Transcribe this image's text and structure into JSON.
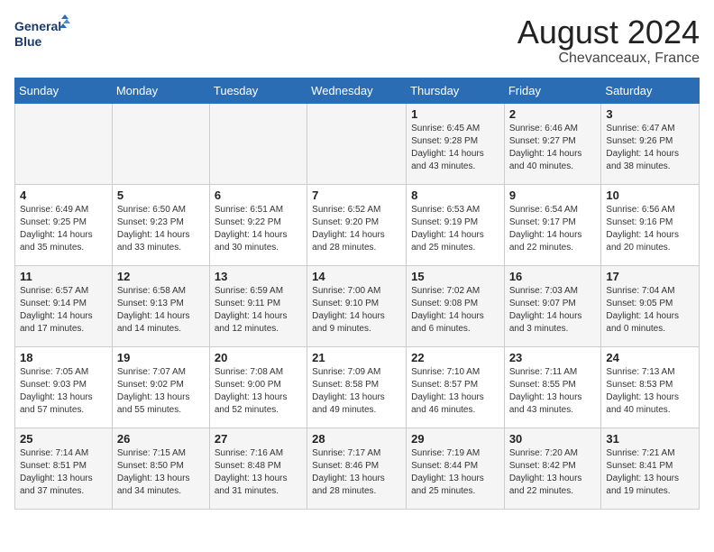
{
  "header": {
    "logo_line1": "General",
    "logo_line2": "Blue",
    "month": "August 2024",
    "location": "Chevanceaux, France"
  },
  "weekdays": [
    "Sunday",
    "Monday",
    "Tuesday",
    "Wednesday",
    "Thursday",
    "Friday",
    "Saturday"
  ],
  "weeks": [
    [
      {
        "day": "",
        "info": ""
      },
      {
        "day": "",
        "info": ""
      },
      {
        "day": "",
        "info": ""
      },
      {
        "day": "",
        "info": ""
      },
      {
        "day": "1",
        "info": "Sunrise: 6:45 AM\nSunset: 9:28 PM\nDaylight: 14 hours\nand 43 minutes."
      },
      {
        "day": "2",
        "info": "Sunrise: 6:46 AM\nSunset: 9:27 PM\nDaylight: 14 hours\nand 40 minutes."
      },
      {
        "day": "3",
        "info": "Sunrise: 6:47 AM\nSunset: 9:26 PM\nDaylight: 14 hours\nand 38 minutes."
      }
    ],
    [
      {
        "day": "4",
        "info": "Sunrise: 6:49 AM\nSunset: 9:25 PM\nDaylight: 14 hours\nand 35 minutes."
      },
      {
        "day": "5",
        "info": "Sunrise: 6:50 AM\nSunset: 9:23 PM\nDaylight: 14 hours\nand 33 minutes."
      },
      {
        "day": "6",
        "info": "Sunrise: 6:51 AM\nSunset: 9:22 PM\nDaylight: 14 hours\nand 30 minutes."
      },
      {
        "day": "7",
        "info": "Sunrise: 6:52 AM\nSunset: 9:20 PM\nDaylight: 14 hours\nand 28 minutes."
      },
      {
        "day": "8",
        "info": "Sunrise: 6:53 AM\nSunset: 9:19 PM\nDaylight: 14 hours\nand 25 minutes."
      },
      {
        "day": "9",
        "info": "Sunrise: 6:54 AM\nSunset: 9:17 PM\nDaylight: 14 hours\nand 22 minutes."
      },
      {
        "day": "10",
        "info": "Sunrise: 6:56 AM\nSunset: 9:16 PM\nDaylight: 14 hours\nand 20 minutes."
      }
    ],
    [
      {
        "day": "11",
        "info": "Sunrise: 6:57 AM\nSunset: 9:14 PM\nDaylight: 14 hours\nand 17 minutes."
      },
      {
        "day": "12",
        "info": "Sunrise: 6:58 AM\nSunset: 9:13 PM\nDaylight: 14 hours\nand 14 minutes."
      },
      {
        "day": "13",
        "info": "Sunrise: 6:59 AM\nSunset: 9:11 PM\nDaylight: 14 hours\nand 12 minutes."
      },
      {
        "day": "14",
        "info": "Sunrise: 7:00 AM\nSunset: 9:10 PM\nDaylight: 14 hours\nand 9 minutes."
      },
      {
        "day": "15",
        "info": "Sunrise: 7:02 AM\nSunset: 9:08 PM\nDaylight: 14 hours\nand 6 minutes."
      },
      {
        "day": "16",
        "info": "Sunrise: 7:03 AM\nSunset: 9:07 PM\nDaylight: 14 hours\nand 3 minutes."
      },
      {
        "day": "17",
        "info": "Sunrise: 7:04 AM\nSunset: 9:05 PM\nDaylight: 14 hours\nand 0 minutes."
      }
    ],
    [
      {
        "day": "18",
        "info": "Sunrise: 7:05 AM\nSunset: 9:03 PM\nDaylight: 13 hours\nand 57 minutes."
      },
      {
        "day": "19",
        "info": "Sunrise: 7:07 AM\nSunset: 9:02 PM\nDaylight: 13 hours\nand 55 minutes."
      },
      {
        "day": "20",
        "info": "Sunrise: 7:08 AM\nSunset: 9:00 PM\nDaylight: 13 hours\nand 52 minutes."
      },
      {
        "day": "21",
        "info": "Sunrise: 7:09 AM\nSunset: 8:58 PM\nDaylight: 13 hours\nand 49 minutes."
      },
      {
        "day": "22",
        "info": "Sunrise: 7:10 AM\nSunset: 8:57 PM\nDaylight: 13 hours\nand 46 minutes."
      },
      {
        "day": "23",
        "info": "Sunrise: 7:11 AM\nSunset: 8:55 PM\nDaylight: 13 hours\nand 43 minutes."
      },
      {
        "day": "24",
        "info": "Sunrise: 7:13 AM\nSunset: 8:53 PM\nDaylight: 13 hours\nand 40 minutes."
      }
    ],
    [
      {
        "day": "25",
        "info": "Sunrise: 7:14 AM\nSunset: 8:51 PM\nDaylight: 13 hours\nand 37 minutes."
      },
      {
        "day": "26",
        "info": "Sunrise: 7:15 AM\nSunset: 8:50 PM\nDaylight: 13 hours\nand 34 minutes."
      },
      {
        "day": "27",
        "info": "Sunrise: 7:16 AM\nSunset: 8:48 PM\nDaylight: 13 hours\nand 31 minutes."
      },
      {
        "day": "28",
        "info": "Sunrise: 7:17 AM\nSunset: 8:46 PM\nDaylight: 13 hours\nand 28 minutes."
      },
      {
        "day": "29",
        "info": "Sunrise: 7:19 AM\nSunset: 8:44 PM\nDaylight: 13 hours\nand 25 minutes."
      },
      {
        "day": "30",
        "info": "Sunrise: 7:20 AM\nSunset: 8:42 PM\nDaylight: 13 hours\nand 22 minutes."
      },
      {
        "day": "31",
        "info": "Sunrise: 7:21 AM\nSunset: 8:41 PM\nDaylight: 13 hours\nand 19 minutes."
      }
    ]
  ]
}
